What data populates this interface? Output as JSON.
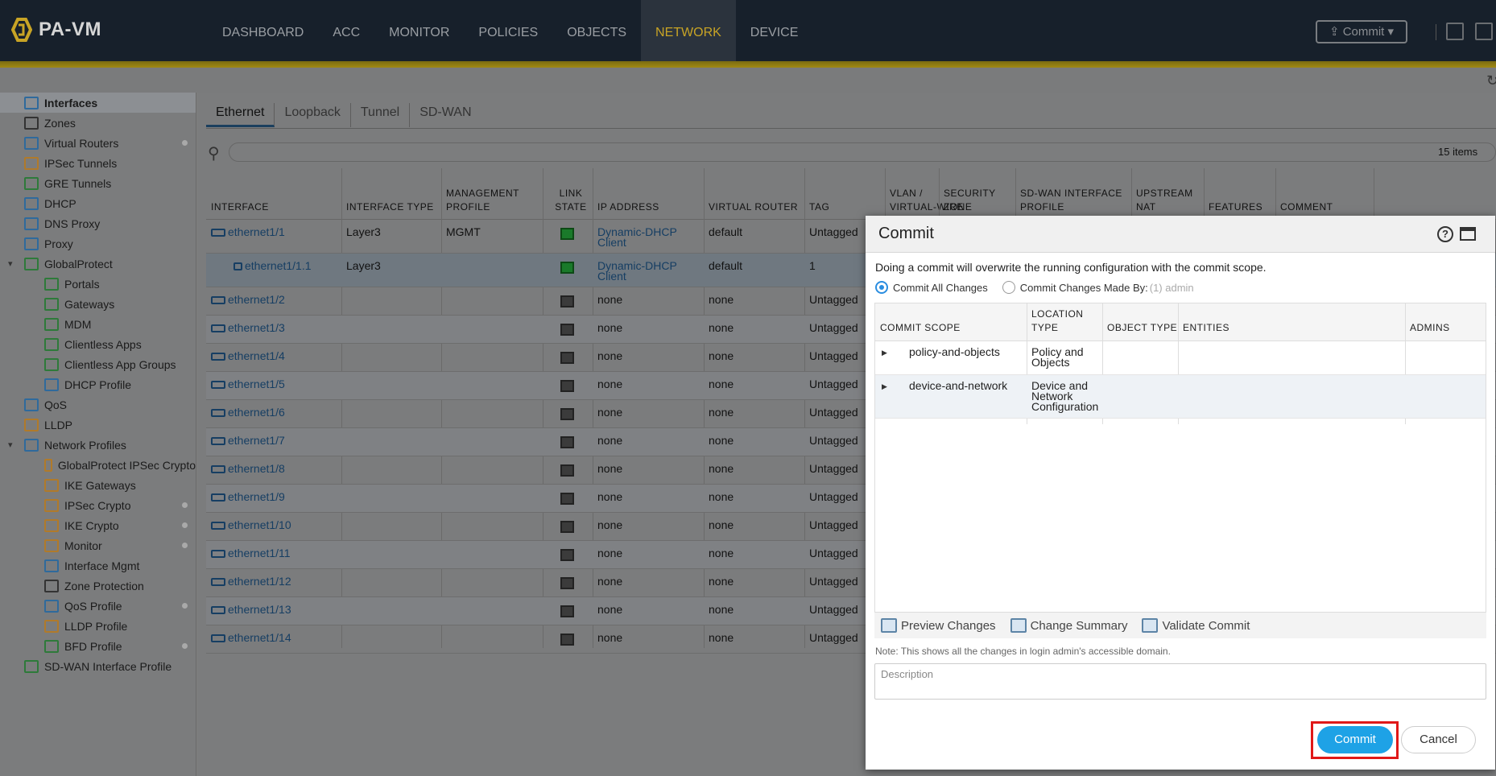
{
  "app": {
    "logo_text": "PA-VM",
    "nav": [
      "DASHBOARD",
      "ACC",
      "MONITOR",
      "POLICIES",
      "OBJECTS",
      "NETWORK",
      "DEVICE"
    ],
    "active_nav": "NETWORK",
    "commit_label": "Commit"
  },
  "sidebar": {
    "items": [
      {
        "label": "Interfaces",
        "indent": 0,
        "selected": true,
        "dot": false,
        "icon_color": "#2f6a9c"
      },
      {
        "label": "Zones",
        "indent": 0,
        "dot": false,
        "icon_color": "#333333"
      },
      {
        "label": "Virtual Routers",
        "indent": 0,
        "dot": true,
        "icon_color": "#2f6a9c"
      },
      {
        "label": "IPSec Tunnels",
        "indent": 0,
        "dot": false,
        "icon_color": "#b07a2a"
      },
      {
        "label": "GRE Tunnels",
        "indent": 0,
        "dot": false,
        "icon_color": "#2e7a3a"
      },
      {
        "label": "DHCP",
        "indent": 0,
        "dot": false,
        "icon_color": "#2f6a9c"
      },
      {
        "label": "DNS Proxy",
        "indent": 0,
        "dot": false,
        "icon_color": "#2f6a9c"
      },
      {
        "label": "Proxy",
        "indent": 0,
        "dot": false,
        "icon_color": "#2f6a9c"
      },
      {
        "label": "GlobalProtect",
        "indent": 0,
        "dot": false,
        "caret": true,
        "icon_color": "#2e7a3a"
      },
      {
        "label": "Portals",
        "indent": 1,
        "dot": false,
        "icon_color": "#2e7a3a"
      },
      {
        "label": "Gateways",
        "indent": 1,
        "dot": false,
        "icon_color": "#2e7a3a"
      },
      {
        "label": "MDM",
        "indent": 1,
        "dot": false,
        "icon_color": "#2e7a3a"
      },
      {
        "label": "Clientless Apps",
        "indent": 1,
        "dot": false,
        "icon_color": "#2e7a3a"
      },
      {
        "label": "Clientless App Groups",
        "indent": 1,
        "dot": false,
        "icon_color": "#2e7a3a"
      },
      {
        "label": "DHCP Profile",
        "indent": 1,
        "dot": false,
        "icon_color": "#2f6a9c"
      },
      {
        "label": "QoS",
        "indent": 0,
        "dot": false,
        "icon_color": "#2f6a9c"
      },
      {
        "label": "LLDP",
        "indent": 0,
        "dot": false,
        "icon_color": "#b07a2a"
      },
      {
        "label": "Network Profiles",
        "indent": 0,
        "dot": false,
        "caret": true,
        "icon_color": "#2f6a9c"
      },
      {
        "label": "GlobalProtect IPSec Crypto",
        "indent": 1,
        "dot": false,
        "icon_color": "#b07a2a"
      },
      {
        "label": "IKE Gateways",
        "indent": 1,
        "dot": false,
        "icon_color": "#b07a2a"
      },
      {
        "label": "IPSec Crypto",
        "indent": 1,
        "dot": true,
        "icon_color": "#b07a2a"
      },
      {
        "label": "IKE Crypto",
        "indent": 1,
        "dot": true,
        "icon_color": "#b07a2a"
      },
      {
        "label": "Monitor",
        "indent": 1,
        "dot": true,
        "icon_color": "#b07a2a"
      },
      {
        "label": "Interface Mgmt",
        "indent": 1,
        "dot": false,
        "icon_color": "#2f6a9c"
      },
      {
        "label": "Zone Protection",
        "indent": 1,
        "dot": false,
        "icon_color": "#333333"
      },
      {
        "label": "QoS Profile",
        "indent": 1,
        "dot": true,
        "icon_color": "#2f6a9c"
      },
      {
        "label": "LLDP Profile",
        "indent": 1,
        "dot": false,
        "icon_color": "#b07a2a"
      },
      {
        "label": "BFD Profile",
        "indent": 1,
        "dot": true,
        "icon_color": "#2e7a3a"
      },
      {
        "label": "SD-WAN Interface Profile",
        "indent": 0,
        "dot": false,
        "icon_color": "#2e7a3a"
      }
    ]
  },
  "tabs": [
    "Ethernet",
    "Loopback",
    "Tunnel",
    "SD-WAN"
  ],
  "active_tab": "Ethernet",
  "items_count": "15 items",
  "table": {
    "columns": [
      "INTERFACE",
      "INTERFACE TYPE",
      "MANAGEMENT PROFILE",
      "LINK STATE",
      "IP ADDRESS",
      "VIRTUAL ROUTER",
      "TAG",
      "VLAN / VIRTUAL-WIRE",
      "SECURITY ZONE",
      "SD-WAN INTERFACE PROFILE",
      "UPSTREAM NAT",
      "FEATURES",
      "COMMENT"
    ],
    "rows": [
      {
        "interface": "ethernet1/1",
        "type": "Layer3",
        "mgmt": "MGMT",
        "link": "up",
        "ip": "Dynamic-DHCP Client",
        "vr": "default",
        "tag": "Untagged"
      },
      {
        "interface": "ethernet1/1.1",
        "type": "Layer3",
        "mgmt": "",
        "link": "up",
        "ip": "Dynamic-DHCP Client",
        "vr": "default",
        "tag": "1",
        "sub": true
      },
      {
        "interface": "ethernet1/2",
        "type": "",
        "mgmt": "",
        "link": "down",
        "ip": "none",
        "vr": "none",
        "tag": "Untagged"
      },
      {
        "interface": "ethernet1/3",
        "type": "",
        "mgmt": "",
        "link": "down",
        "ip": "none",
        "vr": "none",
        "tag": "Untagged"
      },
      {
        "interface": "ethernet1/4",
        "type": "",
        "mgmt": "",
        "link": "down",
        "ip": "none",
        "vr": "none",
        "tag": "Untagged"
      },
      {
        "interface": "ethernet1/5",
        "type": "",
        "mgmt": "",
        "link": "down",
        "ip": "none",
        "vr": "none",
        "tag": "Untagged"
      },
      {
        "interface": "ethernet1/6",
        "type": "",
        "mgmt": "",
        "link": "down",
        "ip": "none",
        "vr": "none",
        "tag": "Untagged"
      },
      {
        "interface": "ethernet1/7",
        "type": "",
        "mgmt": "",
        "link": "down",
        "ip": "none",
        "vr": "none",
        "tag": "Untagged"
      },
      {
        "interface": "ethernet1/8",
        "type": "",
        "mgmt": "",
        "link": "down",
        "ip": "none",
        "vr": "none",
        "tag": "Untagged"
      },
      {
        "interface": "ethernet1/9",
        "type": "",
        "mgmt": "",
        "link": "down",
        "ip": "none",
        "vr": "none",
        "tag": "Untagged"
      },
      {
        "interface": "ethernet1/10",
        "type": "",
        "mgmt": "",
        "link": "down",
        "ip": "none",
        "vr": "none",
        "tag": "Untagged"
      },
      {
        "interface": "ethernet1/11",
        "type": "",
        "mgmt": "",
        "link": "down",
        "ip": "none",
        "vr": "none",
        "tag": "Untagged"
      },
      {
        "interface": "ethernet1/12",
        "type": "",
        "mgmt": "",
        "link": "down",
        "ip": "none",
        "vr": "none",
        "tag": "Untagged"
      },
      {
        "interface": "ethernet1/13",
        "type": "",
        "mgmt": "",
        "link": "down",
        "ip": "none",
        "vr": "none",
        "tag": "Untagged"
      },
      {
        "interface": "ethernet1/14",
        "type": "",
        "mgmt": "",
        "link": "down",
        "ip": "none",
        "vr": "none",
        "tag": "Untagged"
      }
    ]
  },
  "modal": {
    "title": "Commit",
    "help_icon_text": "?",
    "description": "Doing a commit will overwrite the running configuration with the commit scope.",
    "radio_all": "Commit All Changes",
    "radio_by": "Commit Changes Made By:",
    "admin_hint": "(1) admin",
    "scope_columns": [
      "COMMIT SCOPE",
      "LOCATION TYPE",
      "OBJECT TYPE",
      "ENTITIES",
      "ADMINS"
    ],
    "scope_rows": [
      {
        "scope": "policy-and-objects",
        "location": "Policy and Objects"
      },
      {
        "scope": "device-and-network",
        "location": "Device and Network Configuration"
      }
    ],
    "actions": [
      "Preview Changes",
      "Change Summary",
      "Validate Commit"
    ],
    "note": "Note: This shows all the changes in login admin's accessible domain.",
    "description_placeholder": "Description",
    "commit_button": "Commit",
    "cancel_button": "Cancel"
  },
  "colors": {
    "accent": "#1ea2e6",
    "nav_active": "#c8a425",
    "highlight": "#e01818",
    "link": "#163e63"
  }
}
